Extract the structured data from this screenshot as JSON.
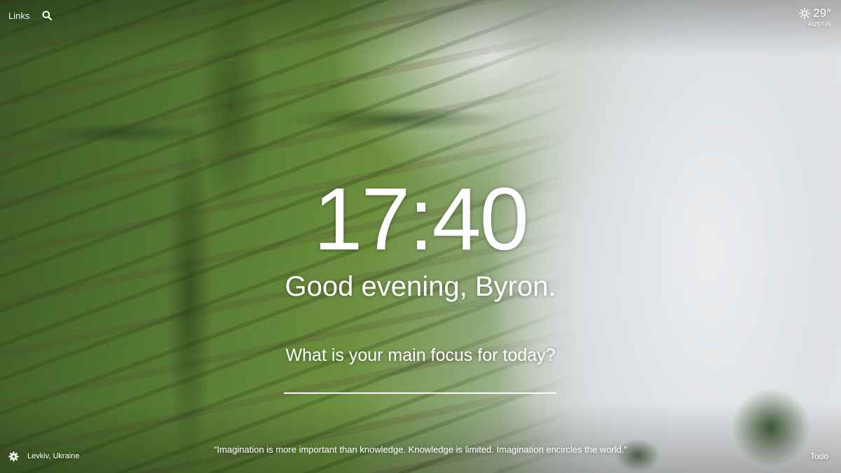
{
  "top_left": {
    "links_label": "Links",
    "search_icon": "search-icon"
  },
  "weather": {
    "icon": "sun-icon",
    "temperature": "29°",
    "city": "AUSTIN"
  },
  "center": {
    "time": "17:40",
    "greeting": "Good evening, Byron.",
    "focus_question": "What is your main focus for today?",
    "focus_value": "",
    "focus_placeholder": ""
  },
  "bottom": {
    "settings_icon": "gear-icon",
    "photo_location": "Levkiv, Ukraine",
    "quote": "“Imagination is more important than knowledge. Knowledge is limited. Imagination encircles the world.”",
    "todo_label": "Todo"
  },
  "colors": {
    "text": "#ffffff"
  }
}
